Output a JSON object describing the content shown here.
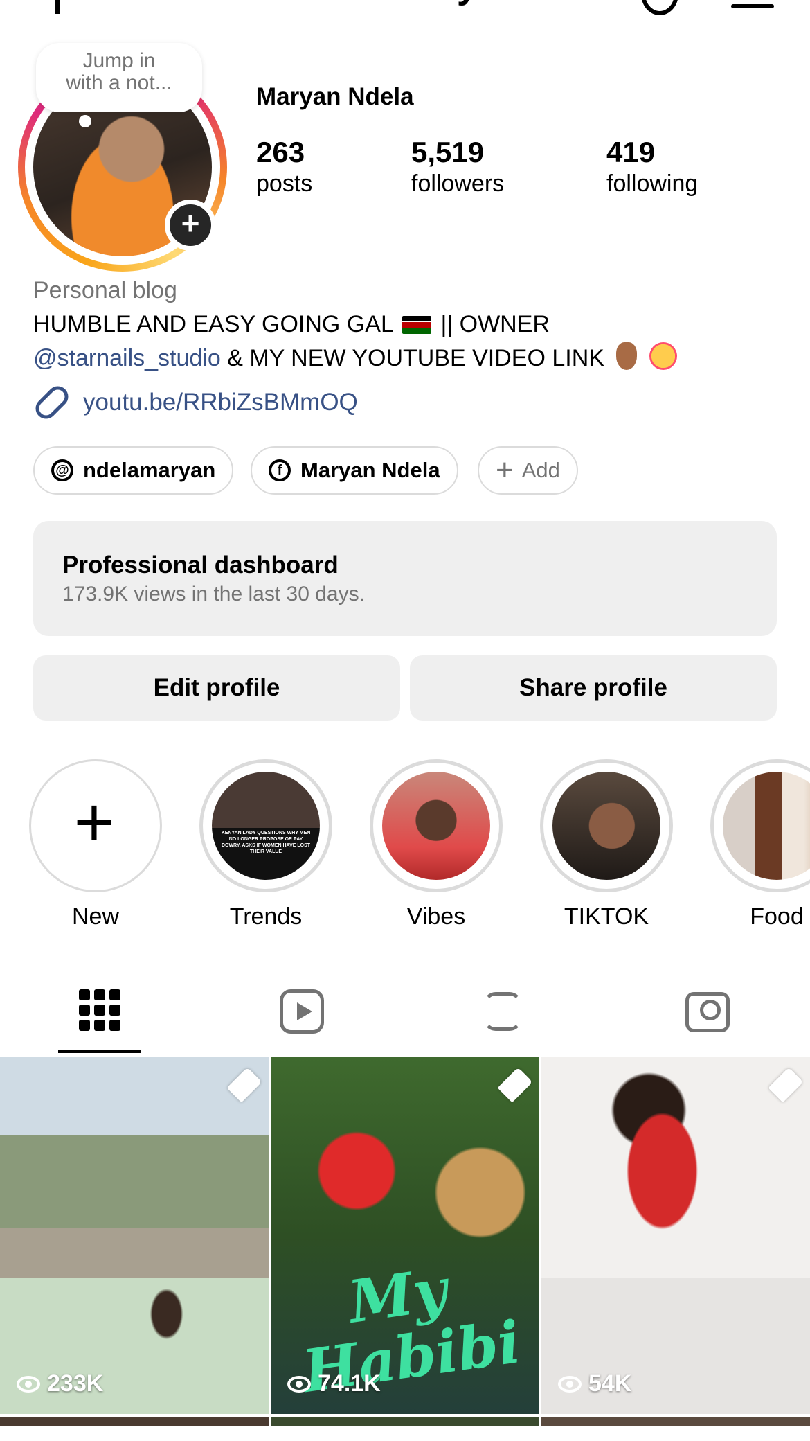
{
  "header": {
    "username": "ndelamaryan"
  },
  "profile": {
    "note": "Jump in\nwith a not...",
    "full_name": "Maryan Ndela",
    "stats": [
      {
        "num": "263",
        "label": "posts"
      },
      {
        "num": "5,519",
        "label": "followers"
      },
      {
        "num": "419",
        "label": "following"
      }
    ]
  },
  "bio": {
    "category": "Personal blog",
    "line1_pre": "HUMBLE AND EASY GOING GAL",
    "line1_post": "|| OWNER",
    "mention": "@starnails_studio",
    "line2_post": "& MY NEW YOUTUBE VIDEO LINK",
    "link": "youtu.be/RRbiZsBMmOQ"
  },
  "chips": {
    "threads": "ndelamaryan",
    "facebook": "Maryan Ndela",
    "add": "Add"
  },
  "dashboard": {
    "title": "Professional dashboard",
    "subtitle": "173.9K views in the last 30 days."
  },
  "buttons": {
    "edit": "Edit profile",
    "share": "Share profile"
  },
  "highlights": [
    {
      "label": "New"
    },
    {
      "label": "Trends"
    },
    {
      "label": "Vibes"
    },
    {
      "label": "TIKTOK"
    },
    {
      "label": "Food"
    }
  ],
  "highlight_overlay": {
    "trends_text": "KENYAN LADY QUESTIONS WHY MEN NO LONGER PROPOSE OR PAY DOWRY, ASKS IF WOMEN HAVE LOST THEIR VALUE"
  },
  "posts": [
    {
      "views": "233K",
      "pinned": true
    },
    {
      "views": "74.1K",
      "pinned": true,
      "overlay": "My Habibi"
    },
    {
      "views": "54K",
      "pinned": true
    }
  ],
  "colors": {
    "link": "#385185",
    "muted": "#737373",
    "panel": "#efefef"
  }
}
